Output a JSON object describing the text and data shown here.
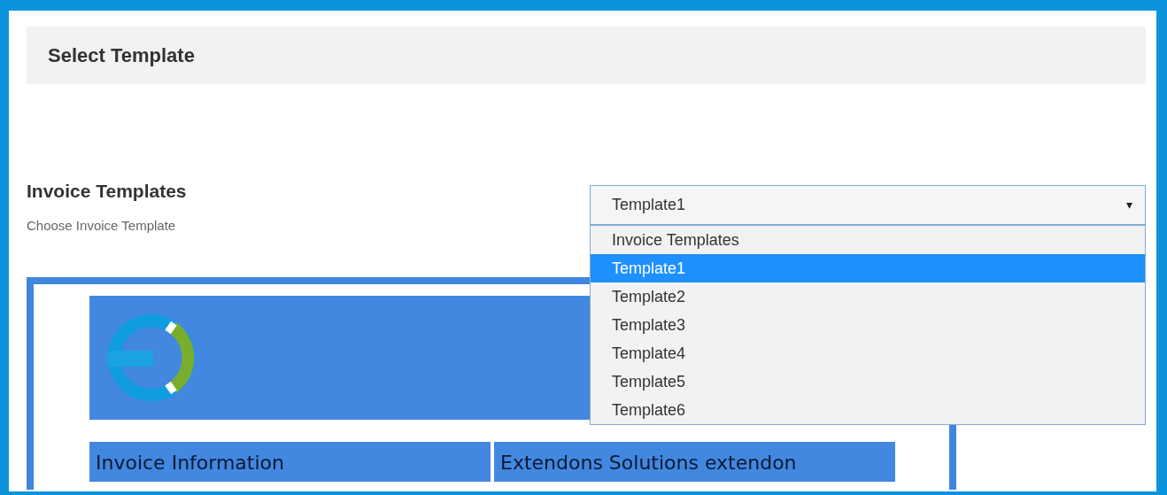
{
  "header": {
    "title": "Select Template"
  },
  "section": {
    "title": "Invoice Templates",
    "description": "Choose Invoice Template"
  },
  "select": {
    "value": "Template1",
    "arrow": "▾",
    "expanded": true,
    "options": [
      {
        "label": "Invoice Templates",
        "selected": false
      },
      {
        "label": "Template1",
        "selected": true
      },
      {
        "label": "Template2",
        "selected": false
      },
      {
        "label": "Template3",
        "selected": false
      },
      {
        "label": "Template4",
        "selected": false
      },
      {
        "label": "Template5",
        "selected": false
      },
      {
        "label": "Template6",
        "selected": false
      }
    ]
  },
  "preview": {
    "cells": [
      "Invoice Information",
      "Extendons Solutions extendon"
    ]
  }
}
